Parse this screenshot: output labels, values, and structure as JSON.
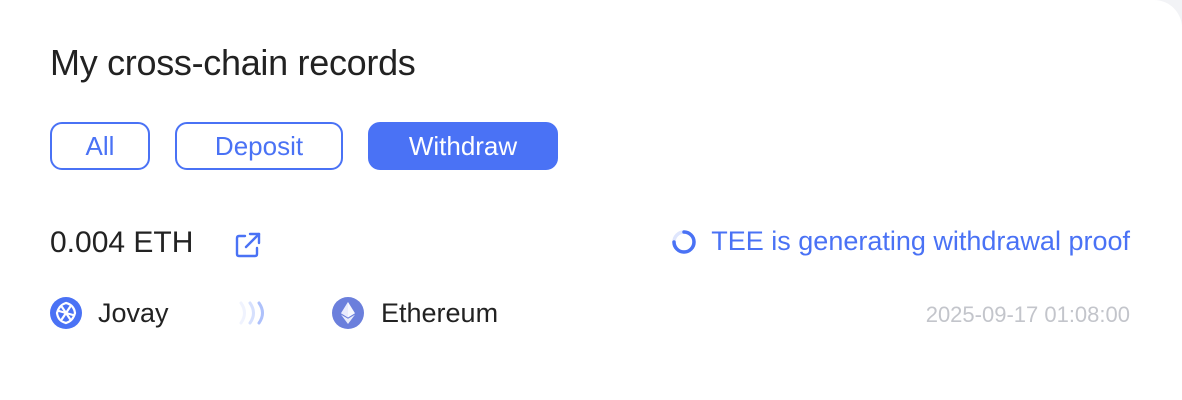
{
  "title": "My cross-chain records",
  "tabs": {
    "all": "All",
    "deposit": "Deposit",
    "withdraw": "Withdraw",
    "active": "Withdraw"
  },
  "record": {
    "amount": "0.004 ETH",
    "status": "TEE is generating withdrawal proof",
    "from_chain": "Jovay",
    "to_chain": "Ethereum",
    "timestamp": "2025-09-17 01:08:00"
  },
  "colors": {
    "accent": "#4a72f5",
    "text": "#222222",
    "muted": "#c3c5cb"
  },
  "icons": {
    "external_link": "external-link-icon",
    "spinner": "loading-spinner-icon",
    "from_chain": "jovay-logo-icon",
    "transfer": "transfer-arrows-icon",
    "to_chain": "ethereum-logo-icon"
  }
}
